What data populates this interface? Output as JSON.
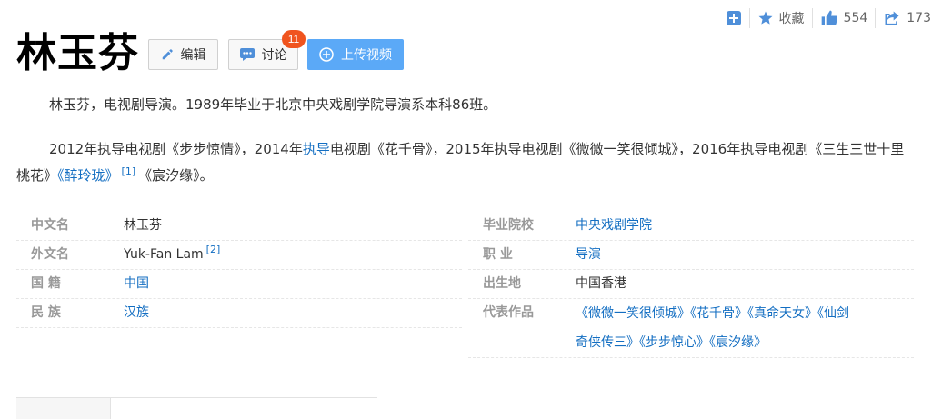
{
  "toolbar": {
    "collect_label": "收藏",
    "like_count": "554",
    "share_count": "173"
  },
  "title": "林玉芬",
  "buttons": {
    "edit": "编辑",
    "discuss": "讨论",
    "discuss_badge": "11",
    "upload": "上传视频"
  },
  "summary": "林玉芬，电视剧导演。1989年毕业于北京中央戏剧学院导演系本科86班。",
  "career": {
    "p1": "2012年执导电视剧《步步惊情》，2014年",
    "link_zhidao": "执导",
    "p2": "电视剧《花千骨》，2015年执导电视剧《微微一笑很倾城》，2016年执导电视剧《三生三世十里桃花》",
    "link_zuilinglong": "《醉玲珑》",
    "ref": "[1]",
    "p3": "《宸汐缘》。"
  },
  "info_left": {
    "name_k": "中文名",
    "name_v": "林玉芬",
    "foreign_k": "外文名",
    "foreign_v": "Yuk-Fan Lam",
    "foreign_ref": "[2]",
    "nation_k": "国 籍",
    "nation_v": "中国",
    "ethnic_k": "民 族",
    "ethnic_v": "汉族"
  },
  "info_right": {
    "school_k": "毕业院校",
    "school_v": "中央戏剧学院",
    "job_k": "职 业",
    "job_v": "导演",
    "birth_k": "出生地",
    "birth_v": "中国香港",
    "works_k": "代表作品",
    "works_line1": "《微微一笑很倾城》《花千骨》《真命天女》《仙剑",
    "works_line2": "奇侠传三》《步步惊心》《宸汐缘》"
  },
  "colors": {
    "link": "#136ec2",
    "upload_button": "#5ba9f7",
    "badge": "#f0541e"
  }
}
